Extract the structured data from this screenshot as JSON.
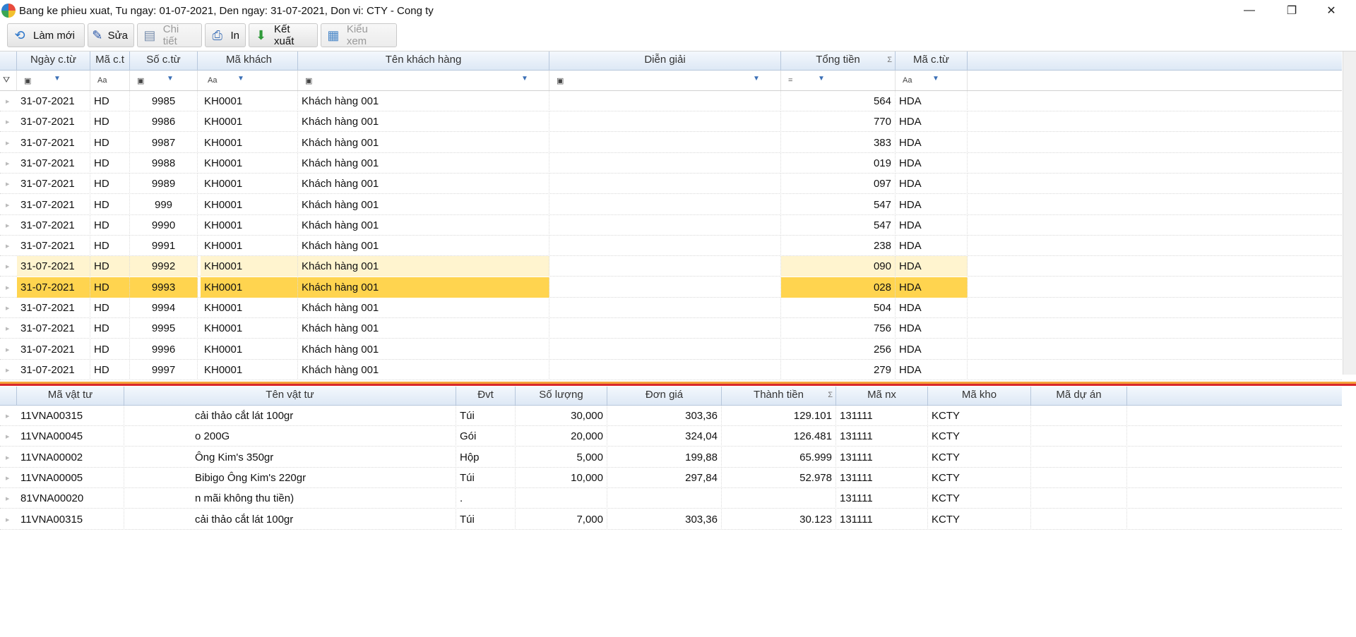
{
  "window": {
    "title": "Bang ke phieu xuat, Tu ngay: 01-07-2021,  Den ngay: 31-07-2021, Don vi: CTY - Cong ty",
    "minimize": "—",
    "restore": "❐",
    "close": "✕"
  },
  "toolbar": {
    "refresh": "Làm mới",
    "edit": "Sửa",
    "detail": "Chi tiết",
    "print": "In",
    "export": "Kết xuất",
    "view": "Kiểu xem"
  },
  "master": {
    "columns": [
      "Ngày c.từ",
      "Mã c.t",
      "Số c.từ",
      "Mã khách",
      "Tên khách hàng",
      "Diễn giải",
      "Tổng tiền",
      "Mã c.từ"
    ],
    "rows": [
      {
        "date": "31-07-2021",
        "type": "HD",
        "no": "9985",
        "cust": "KH0001",
        "name": "Khách hàng 001",
        "desc": "",
        "total": "564",
        "code": "HDA"
      },
      {
        "date": "31-07-2021",
        "type": "HD",
        "no": "9986",
        "cust": "KH0001",
        "name": "Khách hàng 001",
        "desc": "",
        "total": "770",
        "code": "HDA"
      },
      {
        "date": "31-07-2021",
        "type": "HD",
        "no": "9987",
        "cust": "KH0001",
        "name": "Khách hàng 001",
        "desc": "",
        "total": "383",
        "code": "HDA"
      },
      {
        "date": "31-07-2021",
        "type": "HD",
        "no": "9988",
        "cust": "KH0001",
        "name": "Khách hàng 001",
        "desc": "",
        "total": "019",
        "code": "HDA"
      },
      {
        "date": "31-07-2021",
        "type": "HD",
        "no": "9989",
        "cust": "KH0001",
        "name": "Khách hàng 001",
        "desc": "",
        "total": "097",
        "code": "HDA"
      },
      {
        "date": "31-07-2021",
        "type": "HD",
        "no": "999",
        "cust": "KH0001",
        "name": "Khách hàng 001",
        "desc": "",
        "total": "547",
        "code": "HDA"
      },
      {
        "date": "31-07-2021",
        "type": "HD",
        "no": "9990",
        "cust": "KH0001",
        "name": "Khách hàng 001",
        "desc": "",
        "total": "547",
        "code": "HDA"
      },
      {
        "date": "31-07-2021",
        "type": "HD",
        "no": "9991",
        "cust": "KH0001",
        "name": "Khách hàng 001",
        "desc": "",
        "total": "238",
        "code": "HDA"
      },
      {
        "date": "31-07-2021",
        "type": "HD",
        "no": "9992",
        "cust": "KH0001",
        "name": "Khách hàng 001",
        "desc": "",
        "total": "090",
        "code": "HDA"
      },
      {
        "date": "31-07-2021",
        "type": "HD",
        "no": "9993",
        "cust": "KH0001",
        "name": "Khách hàng 001",
        "desc": "",
        "total": "028",
        "code": "HDA"
      },
      {
        "date": "31-07-2021",
        "type": "HD",
        "no": "9994",
        "cust": "KH0001",
        "name": "Khách hàng 001",
        "desc": "",
        "total": "504",
        "code": "HDA"
      },
      {
        "date": "31-07-2021",
        "type": "HD",
        "no": "9995",
        "cust": "KH0001",
        "name": "Khách hàng 001",
        "desc": "",
        "total": "756",
        "code": "HDA"
      },
      {
        "date": "31-07-2021",
        "type": "HD",
        "no": "9996",
        "cust": "KH0001",
        "name": "Khách hàng 001",
        "desc": "",
        "total": "256",
        "code": "HDA"
      },
      {
        "date": "31-07-2021",
        "type": "HD",
        "no": "9997",
        "cust": "KH0001",
        "name": "Khách hàng 001",
        "desc": "",
        "total": "279",
        "code": "HDA"
      }
    ]
  },
  "detail": {
    "columns": [
      "Mã vật tư",
      "Tên vật tư",
      "Đvt",
      "Số lượng",
      "Đơn giá",
      "Thành tiền",
      "Mã nx",
      "Mã kho",
      "Mã dự án"
    ],
    "rows": [
      {
        "item": "11VNA00315",
        "name": "cải thảo cắt lát 100gr",
        "unit": "Túi",
        "qty": "30,000",
        "price": "303,36",
        "amount": "129.101",
        "nx": "131111",
        "wh": "KCTY",
        "proj": ""
      },
      {
        "item": "11VNA00045",
        "name": "o 200G",
        "unit": "Gói",
        "qty": "20,000",
        "price": "324,04",
        "amount": "126.481",
        "nx": "131111",
        "wh": "KCTY",
        "proj": ""
      },
      {
        "item": "11VNA00002",
        "name": "Ông Kim's 350gr",
        "unit": "Hộp",
        "qty": "5,000",
        "price": "199,88",
        "amount": "65.999",
        "nx": "131111",
        "wh": "KCTY",
        "proj": ""
      },
      {
        "item": "11VNA00005",
        "name": "Bibigo Ông Kim's 220gr",
        "unit": "Túi",
        "qty": "10,000",
        "price": "297,84",
        "amount": "52.978",
        "nx": "131111",
        "wh": "KCTY",
        "proj": ""
      },
      {
        "item": "81VNA00020",
        "name": "n mãi không thu tiền)",
        "unit": ".",
        "qty": "",
        "price": "",
        "amount": "",
        "nx": "131111",
        "wh": "KCTY",
        "proj": ""
      },
      {
        "item": "11VNA00315",
        "name": "cải thảo cắt lát 100gr",
        "unit": "Túi",
        "qty": "7,000",
        "price": "303,36",
        "amount": "30.123",
        "nx": "131111",
        "wh": "KCTY",
        "proj": ""
      }
    ]
  },
  "colors": {
    "selected": "#ffd44f",
    "hover": "#fff4cf",
    "header": "#dde8f5",
    "separator": "#d9262c"
  }
}
